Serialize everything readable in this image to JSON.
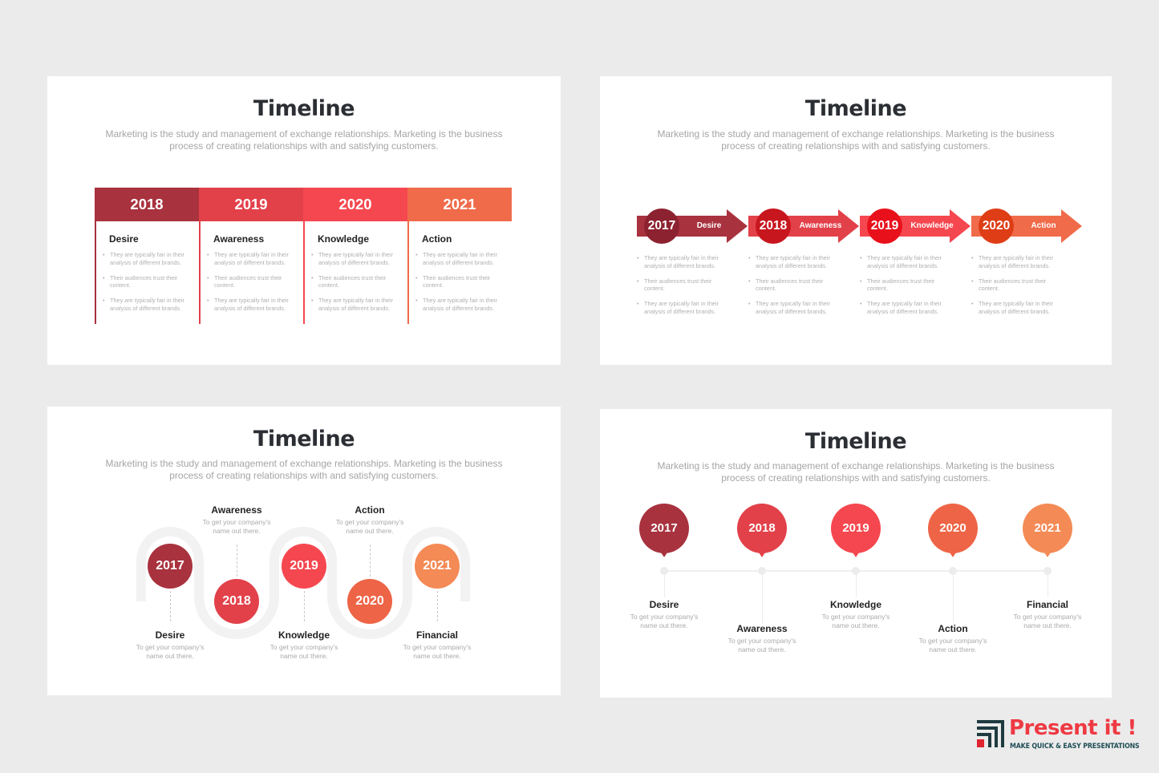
{
  "common": {
    "title": "Timeline",
    "subtitle_line1": "Marketing is the study and management of exchange relationships. Marketing is the business",
    "subtitle_line2": "process of creating relationships with and satisfying customers."
  },
  "slide1": {
    "columns": [
      {
        "year": "2018",
        "name": "Desire",
        "color": "#a8323e",
        "bullets": [
          "They are typically fair in their analysis of different brands.",
          "Their audiences trust their content.",
          "They are typically fair in their analysis of different brands."
        ]
      },
      {
        "year": "2019",
        "name": "Awareness",
        "color": "#e2414a",
        "bullets": [
          "They are typically fair in their analysis of different brands.",
          "Their audiences trust their content.",
          "They are typically fair in their analysis of different brands."
        ]
      },
      {
        "year": "2020",
        "name": "Knowledge",
        "color": "#f5474f",
        "bullets": [
          "They are typically fair in their analysis of different brands.",
          "Their audiences trust their content.",
          "They are typically fair in their analysis of different brands."
        ]
      },
      {
        "year": "2021",
        "name": "Action",
        "color": "#f06b4a",
        "bullets": [
          "They are typically fair in their analysis of different brands.",
          "Their audiences trust their content.",
          "They are typically fair in their analysis of different brands."
        ]
      }
    ]
  },
  "slide2": {
    "steps": [
      {
        "year": "2017",
        "name": "Desire",
        "arrow_color": "#a8323e",
        "circle_color": "#8c2230",
        "bullets": [
          "They are typically fair in their analysis of different brands.",
          "Their audiences trust their content.",
          "They are typically fair in their analysis of different brands."
        ]
      },
      {
        "year": "2018",
        "name": "Awareness",
        "arrow_color": "#e2414a",
        "circle_color": "#c8161e",
        "bullets": [
          "They are typically fair in their analysis of different brands.",
          "Their audiences trust their content.",
          "They are typically fair in their analysis of different brands."
        ]
      },
      {
        "year": "2019",
        "name": "Knowledge",
        "arrow_color": "#f5474f",
        "circle_color": "#e8101b",
        "bullets": [
          "They are typically fair in their analysis of different brands.",
          "Their audiences trust their content.",
          "They are typically fair in their analysis of different brands."
        ]
      },
      {
        "year": "2020",
        "name": "Action",
        "arrow_color": "#f06b4a",
        "circle_color": "#de3d16",
        "bullets": [
          "They are typically fair in their analysis of different brands.",
          "Their audiences trust their content.",
          "They are typically fair in their analysis of different brands."
        ]
      }
    ]
  },
  "slide3": {
    "items": [
      {
        "year": "2017",
        "name": "Desire",
        "desc1": "To get your company's",
        "desc2": "name out there.",
        "color": "#a8323e"
      },
      {
        "year": "2018",
        "name": "Awareness",
        "desc1": "To get your company's",
        "desc2": "name out there.",
        "color": "#e2414a"
      },
      {
        "year": "2019",
        "name": "Knowledge",
        "desc1": "To get your company's",
        "desc2": "name out there.",
        "color": "#f5474f"
      },
      {
        "year": "2020",
        "name": "Action",
        "desc1": "To get your company's",
        "desc2": "name out there.",
        "color": "#ee6446"
      },
      {
        "year": "2021",
        "name": "Financial",
        "desc1": "To get your company's",
        "desc2": "name out there.",
        "color": "#f48a55"
      }
    ]
  },
  "slide4": {
    "items": [
      {
        "year": "2017",
        "name": "Desire",
        "desc1": "To get your company's",
        "desc2": "name out there.",
        "color": "#a8323e"
      },
      {
        "year": "2018",
        "name": "Awareness",
        "desc1": "To get your company's",
        "desc2": "name out there.",
        "color": "#e2414a"
      },
      {
        "year": "2019",
        "name": "Knowledge",
        "desc1": "To get your company's",
        "desc2": "name out there.",
        "color": "#f5474f"
      },
      {
        "year": "2020",
        "name": "Action",
        "desc1": "To get your company's",
        "desc2": "name out there.",
        "color": "#ee6446"
      },
      {
        "year": "2021",
        "name": "Financial",
        "desc1": "To get your company's",
        "desc2": "name out there.",
        "color": "#f48a55"
      }
    ]
  },
  "logo": {
    "brand": "Present it !",
    "tagline": "MAKE QUICK & EASY PRESENTATIONS",
    "red": "#ee3a43",
    "dark": "#1f4e56"
  }
}
